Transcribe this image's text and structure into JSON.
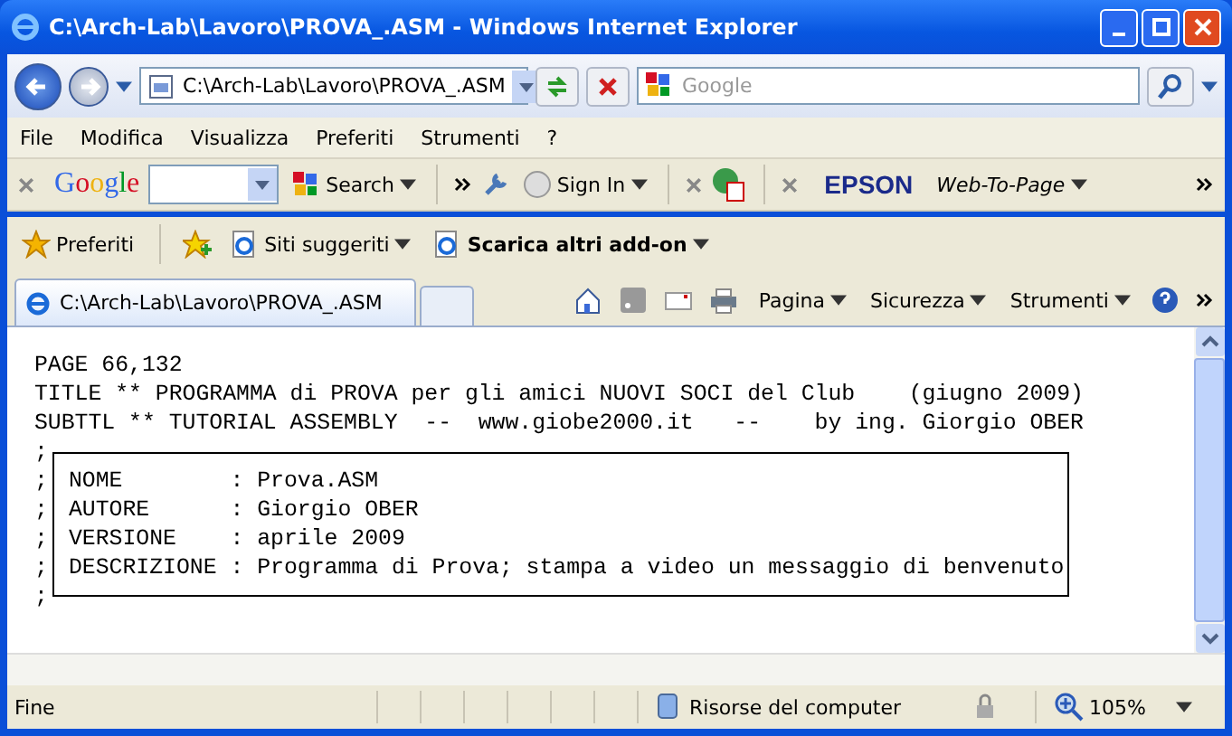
{
  "window": {
    "title": "C:\\Arch-Lab\\Lavoro\\PROVA_.ASM - Windows Internet Explorer"
  },
  "address_bar": {
    "value": "C:\\Arch-Lab\\Lavoro\\PROVA_.ASM"
  },
  "search": {
    "placeholder": "Google"
  },
  "menu": [
    "File",
    "Modifica",
    "Visualizza",
    "Preferiti",
    "Strumenti",
    "?"
  ],
  "google_toolbar": {
    "logo": "Google",
    "search_label": "Search",
    "sign_in": "Sign In",
    "epson": "EPSON",
    "web_to_page": "Web-To-Page"
  },
  "favorites_bar": {
    "label": "Preferiti",
    "links": [
      {
        "label": "Siti suggeriti",
        "bold": false
      },
      {
        "label": "Scarica altri add-on",
        "bold": true
      }
    ]
  },
  "tabs": [
    {
      "label": "C:\\Arch-Lab\\Lavoro\\PROVA_.ASM",
      "selected": true
    }
  ],
  "command_bar": [
    "Pagina",
    "Sicurezza",
    "Strumenti"
  ],
  "document": {
    "lines": [
      "PAGE 66,132",
      "TITLE ** PROGRAMMA di PROVA per gli amici NUOVI SOCI del Club    (giugno 2009)",
      "SUBTTL ** TUTORIAL ASSEMBLY  --  www.giobe2000.it   --    by ing. Giorgio OBER"
    ],
    "box": {
      "top_prefix": ";",
      "rows": [
        {
          "prefix": ";",
          "text": "NOME        : Prova.ASM"
        },
        {
          "prefix": ";",
          "text": "AUTORE      : Giorgio OBER"
        },
        {
          "prefix": ";",
          "text": "VERSIONE    : aprile 2009"
        },
        {
          "prefix": ";",
          "text": "DESCRIZIONE : Programma di Prova; stampa a video un messaggio di benvenuto"
        }
      ],
      "bottom_prefix": ";"
    }
  },
  "status_bar": {
    "text": "Fine",
    "zone": "Risorse del computer",
    "zoom": "105%"
  }
}
